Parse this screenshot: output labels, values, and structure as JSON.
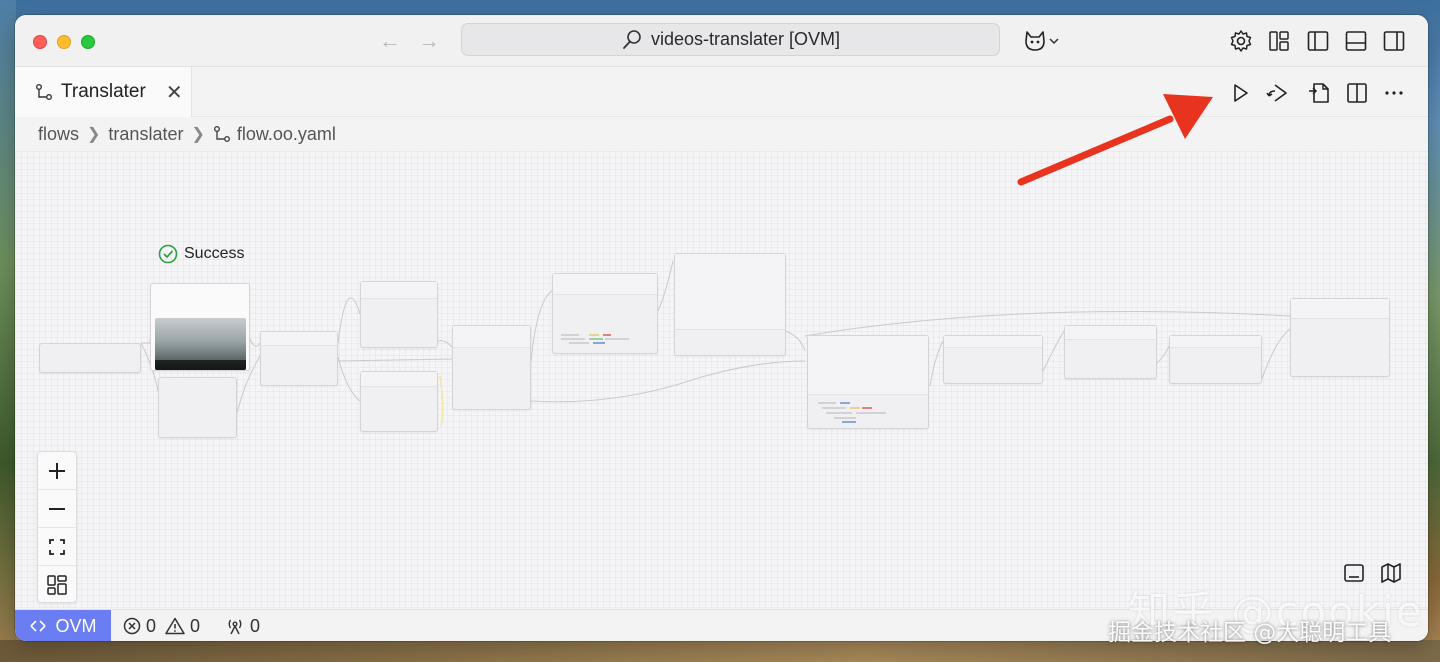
{
  "titlebar": {
    "search_text": "videos-translater [OVM]"
  },
  "tab": {
    "label": "Translater"
  },
  "breadcrumb": {
    "items": [
      "flows",
      "translater",
      "flow.oo.yaml"
    ]
  },
  "canvas": {
    "status_label": "Success"
  },
  "statusbar": {
    "remote_label": "OVM",
    "errors": "0",
    "warnings": "0",
    "ports": "0"
  },
  "watermark": {
    "line1": "知乎 @cookie",
    "line2": "掘金技术社区 @大聪明工具"
  },
  "colors": {
    "remote_bg": "#6b7df2",
    "success_green": "#2ea043",
    "annotation_arrow": "#e8331f"
  }
}
